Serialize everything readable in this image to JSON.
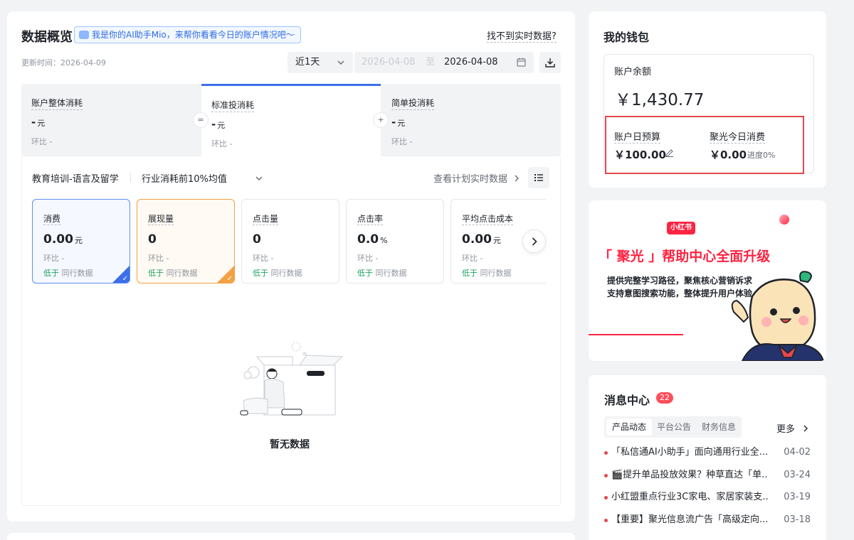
{
  "overview": {
    "title": "数据概览",
    "mio_tip": "我是你的AI助手Mio，来帮你看看今日的账户情况吧～",
    "no_realtime": "找不到实时数据?",
    "update_time": "更新时间：2026-04-09",
    "period": "近1天",
    "date_start": "2026-04-08",
    "date_to": "至",
    "date_end": "2026-04-08"
  },
  "consume_tabs": [
    {
      "label": "账户整体消耗",
      "value": "-",
      "unit": "元",
      "compare": "环比 -"
    },
    {
      "label": "标准投消耗",
      "value": "-",
      "unit": "元",
      "compare": "环比 -"
    },
    {
      "label": "简单投消耗",
      "value": "-",
      "unit": "元",
      "compare": "环比 -"
    }
  ],
  "operators": [
    "=",
    "+"
  ],
  "filter": {
    "industry": "教育培训-语言及留学",
    "benchmark": "行业消耗前10%均值",
    "view_plan": "查看计划实时数据"
  },
  "metrics": [
    {
      "label": "消费",
      "value": "0.00",
      "unit": "元",
      "compare": "环比 -",
      "low": "低于",
      "peer": "同行数据"
    },
    {
      "label": "展现量",
      "value": "0",
      "unit": "",
      "compare": "环比 -",
      "low": "低于",
      "peer": "同行数据"
    },
    {
      "label": "点击量",
      "value": "0",
      "unit": "",
      "compare": "环比 -",
      "low": "低于",
      "peer": "同行数据"
    },
    {
      "label": "点击率",
      "value": "0.0",
      "unit": "%",
      "compare": "环比 -",
      "low": "低于",
      "peer": "同行数据"
    },
    {
      "label": "平均点击成本",
      "value": "0.00",
      "unit": "元",
      "compare": "环比 -",
      "low": "低于",
      "peer": "同行数据"
    }
  ],
  "empty": {
    "text": "暂无数据"
  },
  "wallet": {
    "title": "我的钱包",
    "balance_label": "账户余额",
    "balance": "￥1,430.77",
    "budget_label": "账户日预算",
    "budget": "￥100.00",
    "today_label": "聚光今日消费",
    "today": "￥0.00",
    "progress": "进度0%"
  },
  "banner": {
    "badge": "小红书",
    "headline": "「 聚光 」帮助中心全面升级",
    "line1": "提供完整学习路径，聚焦核心营销诉求",
    "line2": "支持意图搜索功能，整体提升用户体验"
  },
  "messages": {
    "title": "消息中心",
    "count": "22",
    "tabs": [
      "产品动态",
      "平台公告",
      "财务信息"
    ],
    "more": "更多",
    "items": [
      {
        "title": "「私信通AI小助手」面向通用行业全...",
        "date": "04-02"
      },
      {
        "title": "🎬提升单品投放效果？种草直达「单...",
        "date": "03-24"
      },
      {
        "title": "小红盟重点行业3C家电、家居家装支...",
        "date": "03-19"
      },
      {
        "title": "【重要】聚光信息流广告「高级定向...",
        "date": "03-18"
      }
    ]
  },
  "colors": {
    "accent": "#3d6fe8",
    "brand_red": "#ff2442",
    "success": "#20a162",
    "highlight": "#e5484d"
  }
}
